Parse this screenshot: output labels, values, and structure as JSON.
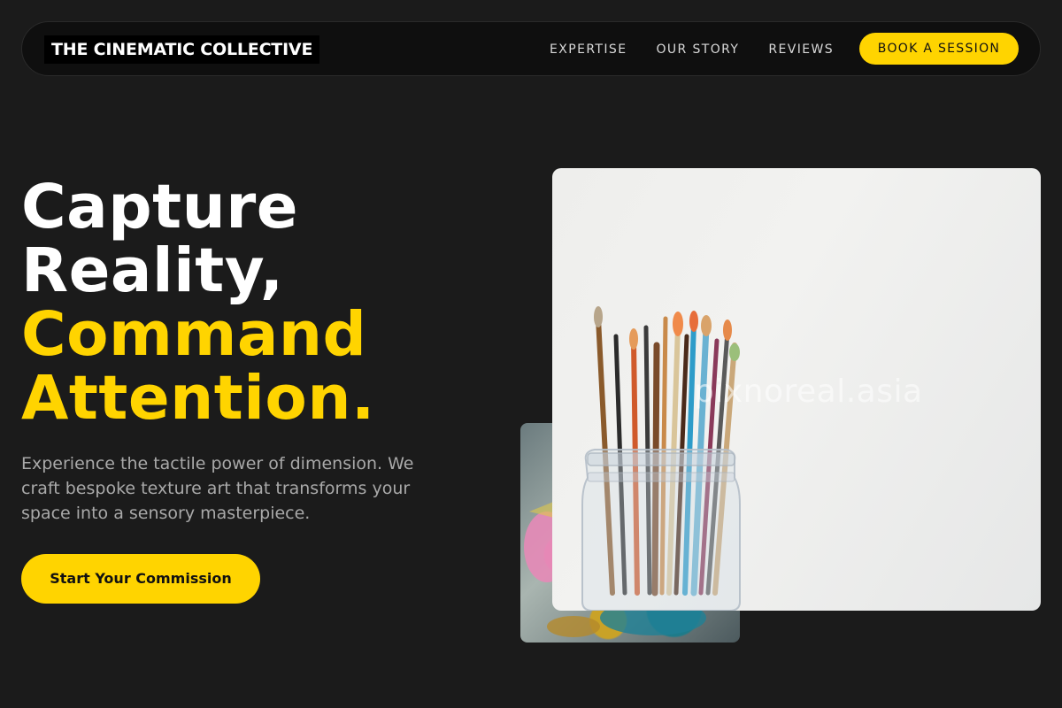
{
  "nav": {
    "brand": "THE CINEMATIC COLLECTIVE",
    "links": [
      "EXPERTISE",
      "OUR STORY",
      "REVIEWS"
    ],
    "cta": "BOOK A SESSION"
  },
  "hero": {
    "title_line1": "Capture",
    "title_line2": "Reality,",
    "title_line3": "Command",
    "title_line4": "Attention.",
    "subtitle": "Experience the tactile power of dimension. We craft bespoke texture art that transforms your space into a sensory masterpiece.",
    "cta": "Start Your Commission"
  },
  "images": {
    "main_watermark": "pixnoreal.asia"
  },
  "colors": {
    "background": "#1b1b1b",
    "accent": "#ffd400",
    "nav_bg": "#0f0f0f",
    "subtitle": "#a9a9a9"
  }
}
